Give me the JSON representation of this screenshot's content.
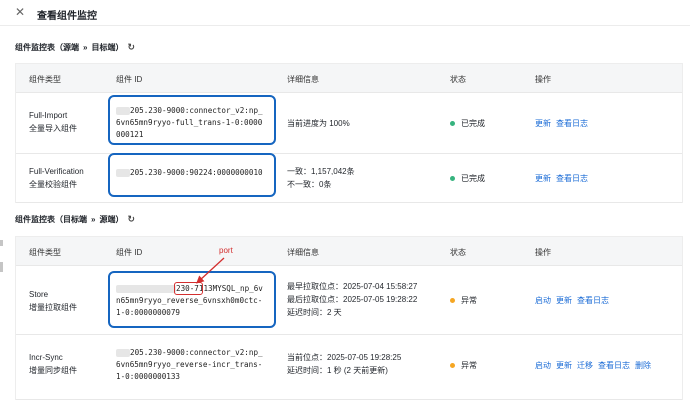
{
  "header": {
    "close_icon": "close-icon",
    "title": "查看组件监控"
  },
  "section1": {
    "title_part1": "组件监控表（源端",
    "separator": "»",
    "title_part2": "目标端）"
  },
  "section2": {
    "title_part1": "组件监控表（目标端",
    "separator": "»",
    "title_part2": "源端）"
  },
  "columns": {
    "type": "组件类型",
    "id": "组件 ID",
    "detail": "详细信息",
    "status": "状态",
    "ops": "操作"
  },
  "table1": {
    "rows": [
      {
        "type_name": "Full-Import",
        "type_desc": "全量导入组件",
        "id_text": "205.230-9000:connector_v2:np_6vn65mn9ryyo-full_trans-1-0:0000000121",
        "detail_lines": [
          "当前进度为 100%"
        ],
        "status": "已完成",
        "ops": [
          "更新",
          "查看日志"
        ]
      },
      {
        "type_name": "Full-Verification",
        "type_desc": "全量校验组件",
        "id_text": "205.230-9000:90224:0000000010",
        "detail_lines": [
          "一致：1,157,042条",
          "不一致：0条"
        ],
        "status": "已完成",
        "ops": [
          "更新",
          "查看日志"
        ]
      }
    ]
  },
  "table2": {
    "rows": [
      {
        "type_name": "Store",
        "type_desc": "增量拉取组件",
        "id_prefix": "230-",
        "id_port": "7113",
        "id_rest": "MYSQL_np_6vn65mn9ryyo_reverse_6vnsxh0m0ctc-1-0:0000000079",
        "detail_lines": [
          "最早拉取位点：2025-07-04 15:58:27",
          "最后拉取位点：2025-07-05 19:28:22",
          "延迟时间：2 天"
        ],
        "status": "异常",
        "ops": [
          "启动",
          "更新",
          "查看日志"
        ]
      },
      {
        "type_name": "Incr-Sync",
        "type_desc": "增量同步组件",
        "id_text": "205.230-9000:connector_v2:np_6vn65mn9ryyo_reverse-incr_trans-1-0:0000000133",
        "detail_lines": [
          "当前位点：2025-07-05 19:28:25",
          "延迟时间：1 秒 (2 天前更新)"
        ],
        "status": "异常",
        "ops": [
          "启动",
          "更新",
          "迁移",
          "查看日志",
          "删除"
        ]
      }
    ]
  },
  "annotation": {
    "port_label": "port"
  },
  "colors": {
    "done": "#36b37e",
    "abnormal": "#f5a623",
    "link": "#1a6bd6",
    "annotation_blue": "#1565c0",
    "annotation_red": "#d32f2f"
  }
}
